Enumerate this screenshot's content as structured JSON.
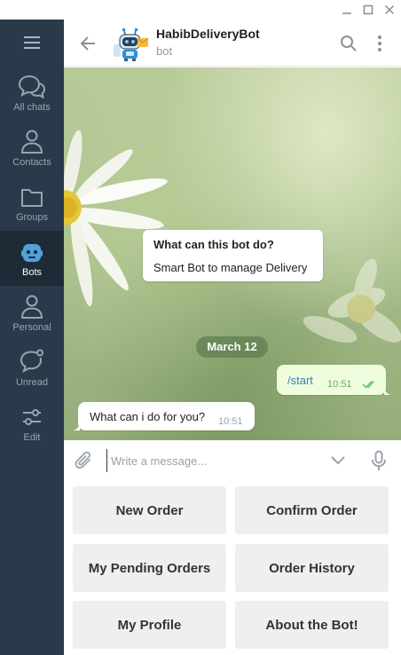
{
  "window": {
    "minimize_icon": "minimize-icon",
    "maximize_icon": "maximize-icon",
    "close_icon": "close-icon"
  },
  "sidebar": {
    "menu_icon": "hamburger-icon",
    "folders": [
      {
        "label": "All chats",
        "icon": "chats-icon",
        "active": false
      },
      {
        "label": "Contacts",
        "icon": "contact-icon",
        "active": false
      },
      {
        "label": "Groups",
        "icon": "folder-icon",
        "active": false
      },
      {
        "label": "Bots",
        "icon": "bot-icon",
        "active": true
      },
      {
        "label": "Personal",
        "icon": "person-icon",
        "active": false
      },
      {
        "label": "Unread",
        "icon": "unread-chat-icon",
        "active": false
      },
      {
        "label": "Edit",
        "icon": "sliders-icon",
        "active": false
      }
    ]
  },
  "header": {
    "title": "HabibDeliveryBot",
    "status": "bot",
    "back_icon": "arrow-left-icon",
    "search_icon": "search-icon",
    "more_icon": "more-vertical-icon"
  },
  "chat": {
    "bot_info": {
      "question": "What can this bot do?",
      "description": "Smart Bot to manage Delivery"
    },
    "date_separator": "March 12",
    "messages": [
      {
        "direction": "out",
        "text": "/start",
        "time": "10:51",
        "read": true
      },
      {
        "direction": "in",
        "text": "What can i do for you?",
        "time": "10:51"
      }
    ]
  },
  "composer": {
    "placeholder": "Write a message...",
    "value": "",
    "attach_icon": "paperclip-icon",
    "keyboard_toggle_icon": "chevron-down-icon",
    "mic_icon": "microphone-icon"
  },
  "keyboard": {
    "buttons": [
      "New Order",
      "Confirm Order",
      "My Pending Orders",
      "Order History",
      "My Profile",
      "About the Bot!"
    ]
  },
  "colors": {
    "sidebar_bg": "#2b3a4a",
    "sidebar_active_bg": "#1f2a37",
    "sidebar_label": "#97a5b2",
    "accent": "#4fa3d8",
    "outgoing_bubble": "#effdde",
    "date_pill": "#5d7d52"
  }
}
